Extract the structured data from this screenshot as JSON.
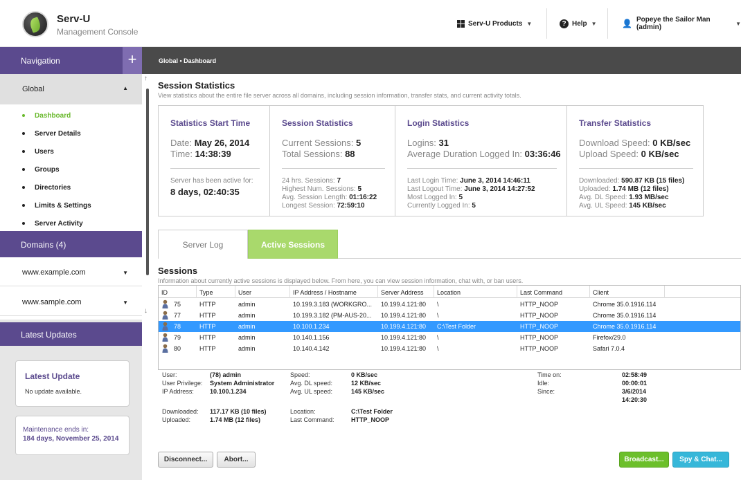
{
  "header": {
    "brand": "Serv-U",
    "brand_sub": "Management Console",
    "products": "Serv-U Products",
    "help": "Help",
    "user": "Popeye the Sailor Man (admin)"
  },
  "sidebar": {
    "nav_title": "Navigation",
    "global": "Global",
    "items": [
      "Dashboard",
      "Server Details",
      "Users",
      "Groups",
      "Directories",
      "Limits & Settings",
      "Server Activity"
    ],
    "domains_title": "Domains (4)",
    "domains": [
      "www.example.com",
      "www.sample.com"
    ],
    "updates_title": "Latest Updates",
    "latest_update_title": "Latest Update",
    "latest_update_text": "No update available.",
    "maintenance_label": "Maintenance ends in:",
    "maintenance_value": "184 days, November 25, 2014"
  },
  "breadcrumb": "Global • Dashboard",
  "session_stats": {
    "title": "Session Statistics",
    "desc": "View statistics about the entire file server across all domains, including session information, transfer stats, and current activity totals.",
    "start": {
      "title": "Statistics Start Time",
      "date_label": "Date:",
      "date": "May 26, 2014",
      "time_label": "Time:",
      "time": "14:38:39",
      "active_label": "Server has been active for:",
      "active_value": "8 days, 02:40:35"
    },
    "session": {
      "title": "Session Statistics",
      "current_label": "Current Sessions:",
      "current": "5",
      "total_label": "Total Sessions:",
      "total": "88",
      "h24_label": "24 hrs. Sessions:",
      "h24": "7",
      "highest_label": "Highest Num. Sessions:",
      "highest": "5",
      "avg_label": "Avg. Session Length:",
      "avg": "01:16:22",
      "longest_label": "Longest Session:",
      "longest": "72:59:10"
    },
    "login": {
      "title": "Login Statistics",
      "logins_label": "Logins:",
      "logins": "31",
      "avgdur_label": "Average Duration Logged In:",
      "avgdur": "03:36:46",
      "lastin_label": "Last Login Time:",
      "lastin": "June 3, 2014 14:46:11",
      "lastout_label": "Last Logout Time:",
      "lastout": "June 3, 2014 14:27:52",
      "most_label": "Most Logged In:",
      "most": "5",
      "curr_label": "Currently Logged In:",
      "curr": "5"
    },
    "transfer": {
      "title": "Transfer Statistics",
      "dl_label": "Download Speed:",
      "dl": "0 KB/sec",
      "ul_label": "Upload Speed:",
      "ul": "0 KB/sec",
      "downloaded_label": "Downloaded:",
      "downloaded": "590.87 KB (15 files)",
      "uploaded_label": "Uploaded:",
      "uploaded": "1.74 MB (12 files)",
      "avgdl_label": "Avg. DL Speed:",
      "avgdl": "1.93 MB/sec",
      "avgul_label": "Avg. UL Speed:",
      "avgul": "145 KB/sec"
    }
  },
  "tabs": {
    "server_log": "Server Log",
    "active_sessions": "Active Sessions"
  },
  "sessions": {
    "title": "Sessions",
    "desc": "Information about currently active sessions is displayed below. From here, you can view session information, chat with, or ban users.",
    "columns": [
      "ID",
      "Type",
      "User",
      "IP Address / Hostname",
      "Server Address",
      "Location",
      "Last Command",
      "Client"
    ],
    "rows": [
      [
        "75",
        "HTTP",
        "admin",
        "10.199.3.183 (WORKGRO...",
        "10.199.4.121:80",
        "\\",
        "HTTP_NOOP",
        "Chrome 35.0.1916.114"
      ],
      [
        "77",
        "HTTP",
        "admin",
        "10.199.3.182 (PM-AUS-20...",
        "10.199.4.121:80",
        "\\",
        "HTTP_NOOP",
        "Chrome 35.0.1916.114"
      ],
      [
        "78",
        "HTTP",
        "admin",
        "10.100.1.234",
        "10.199.4.121:80",
        "C:\\Test Folder",
        "HTTP_NOOP",
        "Chrome 35.0.1916.114"
      ],
      [
        "79",
        "HTTP",
        "admin",
        "10.140.1.156",
        "10.199.4.121:80",
        "\\",
        "HTTP_NOOP",
        "Firefox/29.0"
      ],
      [
        "80",
        "HTTP",
        "admin",
        "10.140.4.142",
        "10.199.4.121:80",
        "\\",
        "HTTP_NOOP",
        "Safari 7.0.4"
      ]
    ],
    "selected_row": 2
  },
  "details": {
    "user_label": "User:",
    "user": "(78) admin",
    "priv_label": "User Privilege:",
    "priv": "System Administrator",
    "ip_label": "IP Address:",
    "ip": "10.100.1.234",
    "speed_label": "Speed:",
    "speed": "0 KB/sec",
    "avgdl_label": "Avg. DL speed:",
    "avgdl": "12 KB/sec",
    "avgul_label": "Avg. UL speed:",
    "avgul": "145 KB/sec",
    "timeon_label": "Time on:",
    "timeon": "02:58:49",
    "idle_label": "Idle:",
    "idle": "00:00:01",
    "since_label": "Since:",
    "since": "3/6/2014",
    "since_time": "14:20:30",
    "downloaded_label": "Downloaded:",
    "downloaded": "117.17 KB (10 files)",
    "uploaded_label": "Uploaded:",
    "uploaded": "1.74 MB (12 files)",
    "location_label": "Location:",
    "location": "C:\\Test Folder",
    "lastcmd_label": "Last Command:",
    "lastcmd": "HTTP_NOOP"
  },
  "buttons": {
    "disconnect": "Disconnect...",
    "abort": "Abort...",
    "broadcast": "Broadcast...",
    "spy_chat": "Spy & Chat..."
  },
  "colors": {
    "purple": "#5b4a8e",
    "green": "#6ab92d",
    "tab_green": "#a9d96c",
    "select": "#3399ff",
    "blue_btn": "#36b7d9"
  }
}
